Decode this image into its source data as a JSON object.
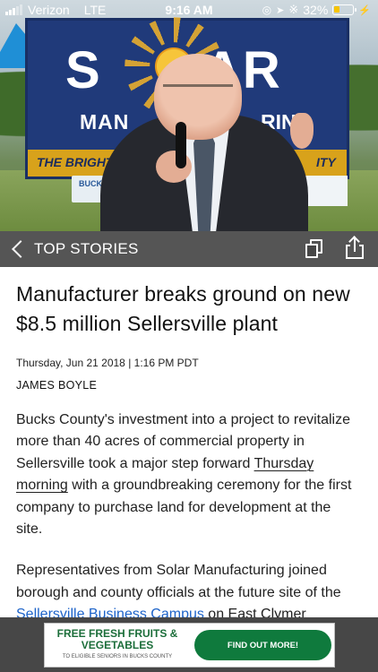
{
  "status_bar": {
    "carrier": "Verizon",
    "network": "LTE",
    "time": "9:16 AM",
    "battery": "32%",
    "battery_level": 0.32
  },
  "hero": {
    "banner_word_left": "S",
    "banner_word_right": "AR",
    "banner_sub_left": "MAN",
    "banner_sub_right": "RING",
    "banner_tag_left": "THE BRIGHT",
    "banner_tag_right": "ITY",
    "sign_text": "BUCK"
  },
  "nav": {
    "back_label": "TOP STORIES",
    "icons": [
      "back-chevron-icon",
      "copy-icon",
      "share-icon"
    ]
  },
  "article": {
    "headline": "Manufacturer breaks ground on new $8.5 million Sellersville plant",
    "dateline": "Thursday, Jun 21 2018 | 1:16 PM PDT",
    "byline": "JAMES BOYLE",
    "p1_before": "Bucks County's investment into a project to revitalize more than 40 acres of commercial property in Sellersville took a major step forward ",
    "p1_underlined": "Thursday morning",
    "p1_after": " with a groundbreaking ceremony for the first company to purchase land for development at the site.",
    "p2_before": "Representatives from Solar Manufacturing joined borough and county officials at the future site of the ",
    "p2_link": "Sellersville Business Campus",
    "p2_after": " on East Clymer"
  },
  "ad": {
    "headline": "FREE FRESH FRUITS & VEGETABLES",
    "fine_print": "TO ELIGIBLE SENIORS IN BUCKS COUNTY",
    "cta": "FIND OUT MORE!",
    "brand_color": "#0f7a3d"
  }
}
